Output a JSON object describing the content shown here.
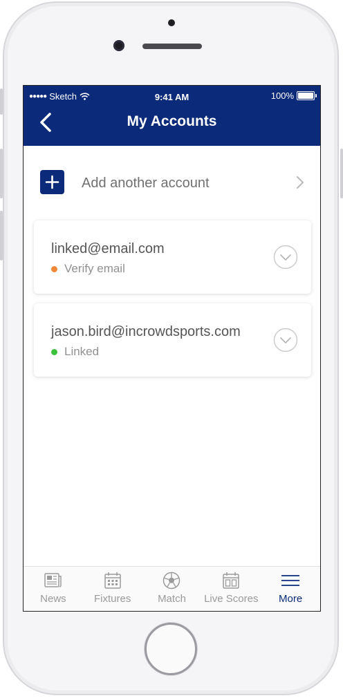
{
  "status_bar": {
    "carrier": "Sketch",
    "time": "9:41 AM",
    "battery": "100%"
  },
  "nav": {
    "title": "My Accounts",
    "back_icon": "chevron-left-icon"
  },
  "add_account": {
    "label": "Add another account",
    "icon": "plus-icon"
  },
  "accounts": [
    {
      "email": "linked@email.com",
      "status": "Verify email",
      "status_color": "#f0883a"
    },
    {
      "email": "jason.bird@incrowdsports.com",
      "status": "Linked",
      "status_color": "#3cc13b"
    }
  ],
  "tabs": [
    {
      "label": "News",
      "icon": "newspaper-icon"
    },
    {
      "label": "Fixtures",
      "icon": "calendar-icon"
    },
    {
      "label": "Match",
      "icon": "football-icon"
    },
    {
      "label": "Live Scores",
      "icon": "scoreboard-icon"
    },
    {
      "label": "More",
      "icon": "menu-icon",
      "active": true
    }
  ],
  "colors": {
    "brand": "#0b2a7a",
    "tab_inactive": "#9a9a9a"
  }
}
